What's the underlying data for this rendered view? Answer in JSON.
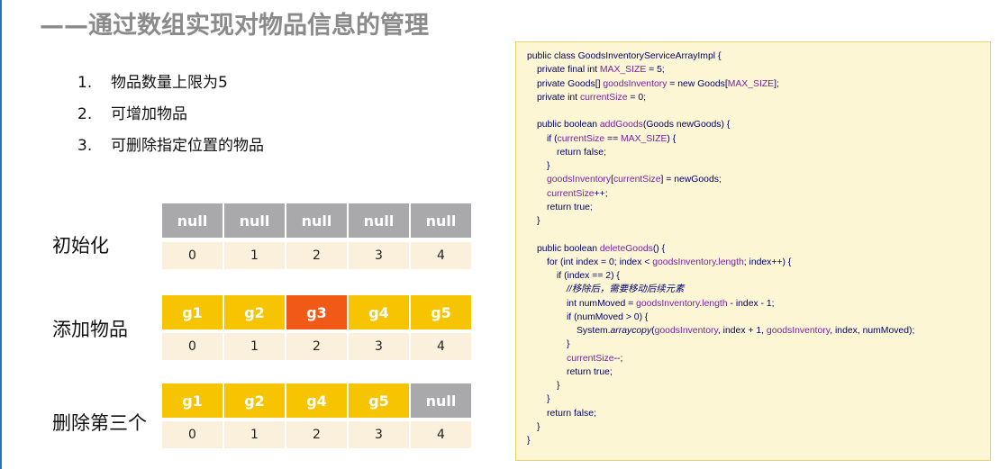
{
  "title": "——通过数组实现对物品信息的管理",
  "requirements": [
    {
      "num": "1.",
      "text": "物品数量上限为5"
    },
    {
      "num": "2.",
      "text": "可增加物品"
    },
    {
      "num": "3.",
      "text": "可删除指定位置的物品"
    }
  ],
  "colors": {
    "null_cell": "#a9a9ab",
    "goods_cell": "#f6c400",
    "highlight_cell": "#f15a16",
    "index_cell": "#fbf0dc",
    "code_bg": "#fdf6d4",
    "code_keyword": "#000066",
    "code_field": "#7a1fa2"
  },
  "arrays": [
    {
      "label": "初始化",
      "cells": [
        {
          "text": "null",
          "kind": "null"
        },
        {
          "text": "null",
          "kind": "null"
        },
        {
          "text": "null",
          "kind": "null"
        },
        {
          "text": "null",
          "kind": "null"
        },
        {
          "text": "null",
          "kind": "null"
        }
      ],
      "indices": [
        "0",
        "1",
        "2",
        "3",
        "4"
      ]
    },
    {
      "label": "添加物品",
      "cells": [
        {
          "text": "g1",
          "kind": "goods"
        },
        {
          "text": "g2",
          "kind": "goods"
        },
        {
          "text": "g3",
          "kind": "highlight"
        },
        {
          "text": "g4",
          "kind": "goods"
        },
        {
          "text": "g5",
          "kind": "goods"
        }
      ],
      "indices": [
        "0",
        "1",
        "2",
        "3",
        "4"
      ]
    },
    {
      "label": "删除第三个",
      "cells": [
        {
          "text": "g1",
          "kind": "goods"
        },
        {
          "text": "g2",
          "kind": "goods"
        },
        {
          "text": "g4",
          "kind": "goods"
        },
        {
          "text": "g5",
          "kind": "goods"
        },
        {
          "text": "null",
          "kind": "null"
        }
      ],
      "indices": [
        "0",
        "1",
        "2",
        "3",
        "4"
      ]
    }
  ],
  "code": [
    {
      "indent": 0,
      "parts": [
        [
          "public class GoodsInventoryServiceArrayImpl {",
          "k"
        ]
      ]
    },
    {
      "indent": 1,
      "parts": [
        [
          "private final int ",
          "k"
        ],
        [
          "MAX_SIZE",
          "f"
        ],
        [
          " = 5;",
          "k"
        ]
      ]
    },
    {
      "indent": 1,
      "parts": [
        [
          "private Goods[] ",
          "k"
        ],
        [
          "goodsInventory",
          "f"
        ],
        [
          " = new Goods[",
          "k"
        ],
        [
          "MAX_SIZE",
          "f"
        ],
        [
          "];",
          "k"
        ]
      ]
    },
    {
      "indent": 1,
      "parts": [
        [
          "private int ",
          "k"
        ],
        [
          "currentSize",
          "f"
        ],
        [
          " = 0;",
          "k"
        ]
      ]
    },
    {
      "indent": 0,
      "parts": []
    },
    {
      "indent": 1,
      "parts": [
        [
          "public boolean ",
          "k"
        ],
        [
          "addGoods",
          "f"
        ],
        [
          "(Goods newGoods) {",
          "k"
        ]
      ]
    },
    {
      "indent": 2,
      "parts": [
        [
          "if (",
          "k"
        ],
        [
          "currentSize",
          "f"
        ],
        [
          " == ",
          "k"
        ],
        [
          "MAX_SIZE",
          "f"
        ],
        [
          ") {",
          "k"
        ]
      ]
    },
    {
      "indent": 3,
      "parts": [
        [
          "return false;",
          "k"
        ]
      ]
    },
    {
      "indent": 2,
      "parts": [
        [
          "}",
          "k"
        ]
      ]
    },
    {
      "indent": 2,
      "parts": [
        [
          "goodsInventory",
          "f"
        ],
        [
          "[",
          "k"
        ],
        [
          "currentSize",
          "f"
        ],
        [
          "] = newGoods;",
          "k"
        ]
      ]
    },
    {
      "indent": 2,
      "parts": [
        [
          "currentSize",
          "f"
        ],
        [
          "++;",
          "k"
        ]
      ]
    },
    {
      "indent": 2,
      "parts": [
        [
          "return true;",
          "k"
        ]
      ]
    },
    {
      "indent": 1,
      "parts": [
        [
          "}",
          "k"
        ]
      ]
    },
    {
      "indent": 0,
      "parts": []
    },
    {
      "indent": 1,
      "parts": [
        [
          "public boolean ",
          "k"
        ],
        [
          "deleteGoods",
          "f"
        ],
        [
          "() {",
          "k"
        ]
      ]
    },
    {
      "indent": 2,
      "parts": [
        [
          "for (int index = 0; index < ",
          "k"
        ],
        [
          "goodsInventory",
          "f"
        ],
        [
          ".",
          "k"
        ],
        [
          "length",
          "f"
        ],
        [
          "; index++) {",
          "k"
        ]
      ]
    },
    {
      "indent": 3,
      "parts": [
        [
          "if (index == 2) {",
          "k"
        ]
      ]
    },
    {
      "indent": 4,
      "parts": [
        [
          "//移除后，需要移动后续元素",
          "c"
        ]
      ]
    },
    {
      "indent": 4,
      "parts": [
        [
          "int numMoved = ",
          "k"
        ],
        [
          "goodsInventory",
          "f"
        ],
        [
          ".",
          "k"
        ],
        [
          "length",
          "f"
        ],
        [
          " - index - 1;",
          "k"
        ]
      ]
    },
    {
      "indent": 4,
      "parts": [
        [
          "if (numMoved > 0) {",
          "k"
        ]
      ]
    },
    {
      "indent": 5,
      "parts": [
        [
          "System.",
          "k"
        ],
        [
          "arraycopy",
          "m"
        ],
        [
          "(",
          "k"
        ],
        [
          "goodsInventory",
          "f"
        ],
        [
          ", index + 1, ",
          "k"
        ],
        [
          "goodsInventory",
          "f"
        ],
        [
          ", index, numMoved);",
          "k"
        ]
      ]
    },
    {
      "indent": 4,
      "parts": [
        [
          "}",
          "k"
        ]
      ]
    },
    {
      "indent": 4,
      "parts": [
        [
          "currentSize",
          "f"
        ],
        [
          "--;",
          "k"
        ]
      ]
    },
    {
      "indent": 4,
      "parts": [
        [
          "return true;",
          "k"
        ]
      ]
    },
    {
      "indent": 3,
      "parts": [
        [
          "}",
          "k"
        ]
      ]
    },
    {
      "indent": 2,
      "parts": [
        [
          "}",
          "k"
        ]
      ]
    },
    {
      "indent": 2,
      "parts": [
        [
          "return false;",
          "k"
        ]
      ]
    },
    {
      "indent": 1,
      "parts": [
        [
          "}",
          "k"
        ]
      ]
    },
    {
      "indent": 0,
      "parts": [
        [
          "}",
          "k"
        ]
      ]
    }
  ]
}
